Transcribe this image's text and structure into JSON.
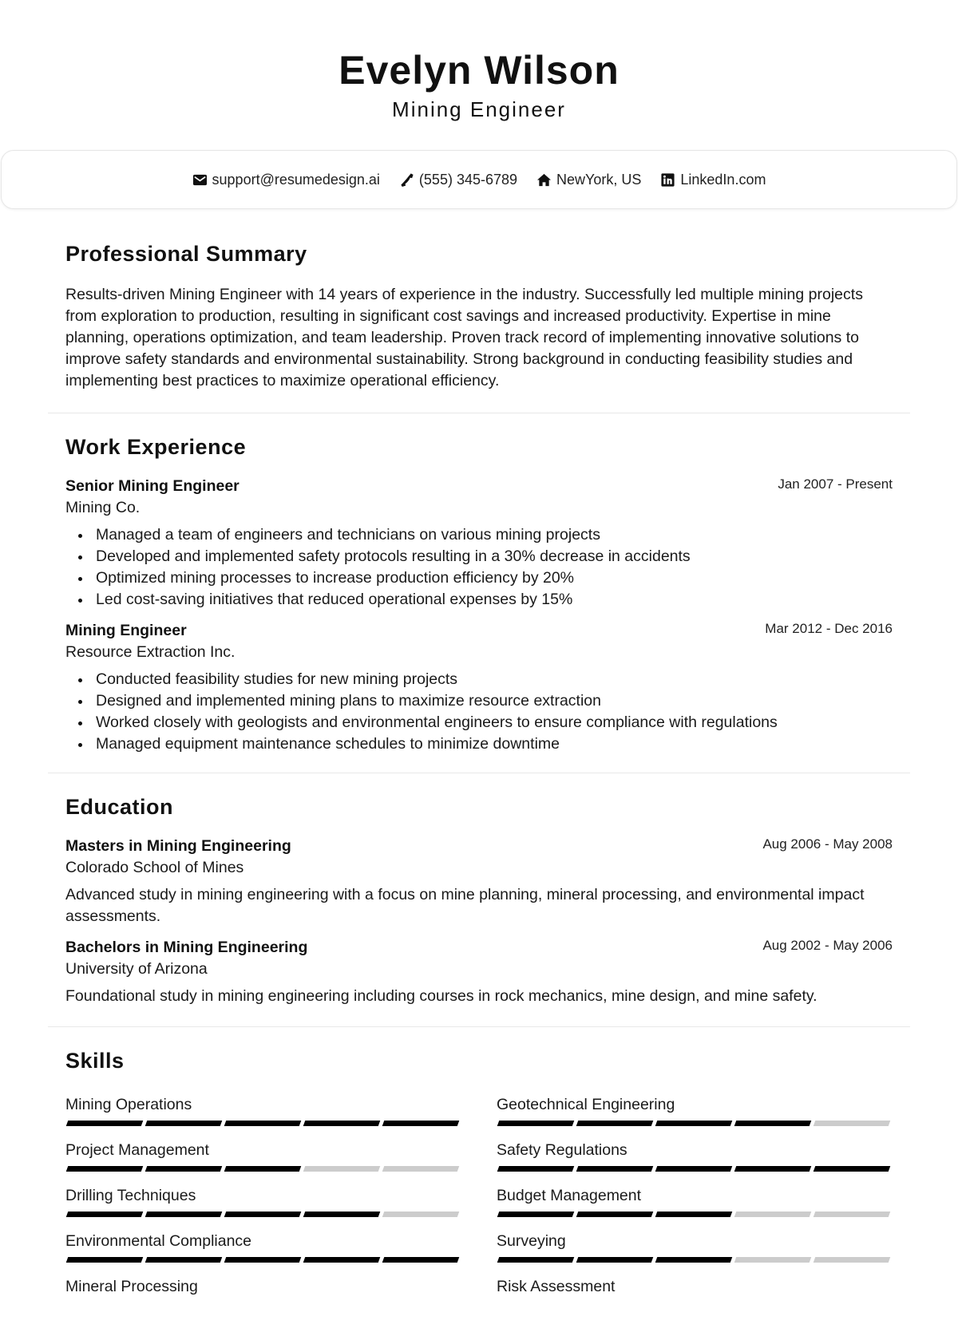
{
  "header": {
    "name": "Evelyn Wilson",
    "title": "Mining Engineer"
  },
  "contact": [
    {
      "icon": "envelope-icon",
      "text": "support@resumedesign.ai"
    },
    {
      "icon": "phone-icon",
      "text": "(555) 345-6789"
    },
    {
      "icon": "home-icon",
      "text": "NewYork, US"
    },
    {
      "icon": "linkedin-icon",
      "text": "LinkedIn.com"
    }
  ],
  "summary": {
    "heading": "Professional Summary",
    "text": "Results-driven Mining Engineer with 14 years of experience in the industry. Successfully led multiple mining projects from exploration to production, resulting in significant cost savings and increased productivity. Expertise in mine planning, operations optimization, and team leadership. Proven track record of implementing innovative solutions to improve safety standards and environmental sustainability. Strong background in conducting feasibility studies and implementing best practices to maximize operational efficiency."
  },
  "experience": {
    "heading": "Work Experience",
    "jobs": [
      {
        "title": "Senior Mining Engineer",
        "company": "Mining Co.",
        "dates": "Jan 2007 - Present",
        "bullets": [
          "Managed a team of engineers and technicians on various mining projects",
          "Developed and implemented safety protocols resulting in a 30% decrease in accidents",
          "Optimized mining processes to increase production efficiency by 20%",
          "Led cost-saving initiatives that reduced operational expenses by 15%"
        ]
      },
      {
        "title": "Mining Engineer",
        "company": "Resource Extraction Inc.",
        "dates": "Mar 2012 - Dec 2016",
        "bullets": [
          "Conducted feasibility studies for new mining projects",
          "Designed and implemented mining plans to maximize resource extraction",
          "Worked closely with geologists and environmental engineers to ensure compliance with regulations",
          "Managed equipment maintenance schedules to minimize downtime"
        ]
      }
    ]
  },
  "education": {
    "heading": "Education",
    "entries": [
      {
        "degree": "Masters in Mining Engineering",
        "school": "Colorado School of Mines",
        "dates": "Aug 2006 - May 2008",
        "description": "Advanced study in mining engineering with a focus on mine planning, mineral processing, and environmental impact assessments."
      },
      {
        "degree": "Bachelors in Mining Engineering",
        "school": "University of Arizona",
        "dates": "Aug 2002 - May 2006",
        "description": "Foundational study in mining engineering including courses in rock mechanics, mine design, and mine safety."
      }
    ]
  },
  "skills": {
    "heading": "Skills",
    "max_level": 5,
    "items": [
      {
        "name": "Mining Operations",
        "level": 5
      },
      {
        "name": "Geotechnical Engineering",
        "level": 4
      },
      {
        "name": "Project Management",
        "level": 3
      },
      {
        "name": "Safety Regulations",
        "level": 5
      },
      {
        "name": "Drilling Techniques",
        "level": 4
      },
      {
        "name": "Budget Management",
        "level": 3
      },
      {
        "name": "Environmental Compliance",
        "level": 5
      },
      {
        "name": "Surveying",
        "level": 3
      },
      {
        "name": "Mineral Processing",
        "level": null
      },
      {
        "name": "Risk Assessment",
        "level": null
      }
    ]
  }
}
